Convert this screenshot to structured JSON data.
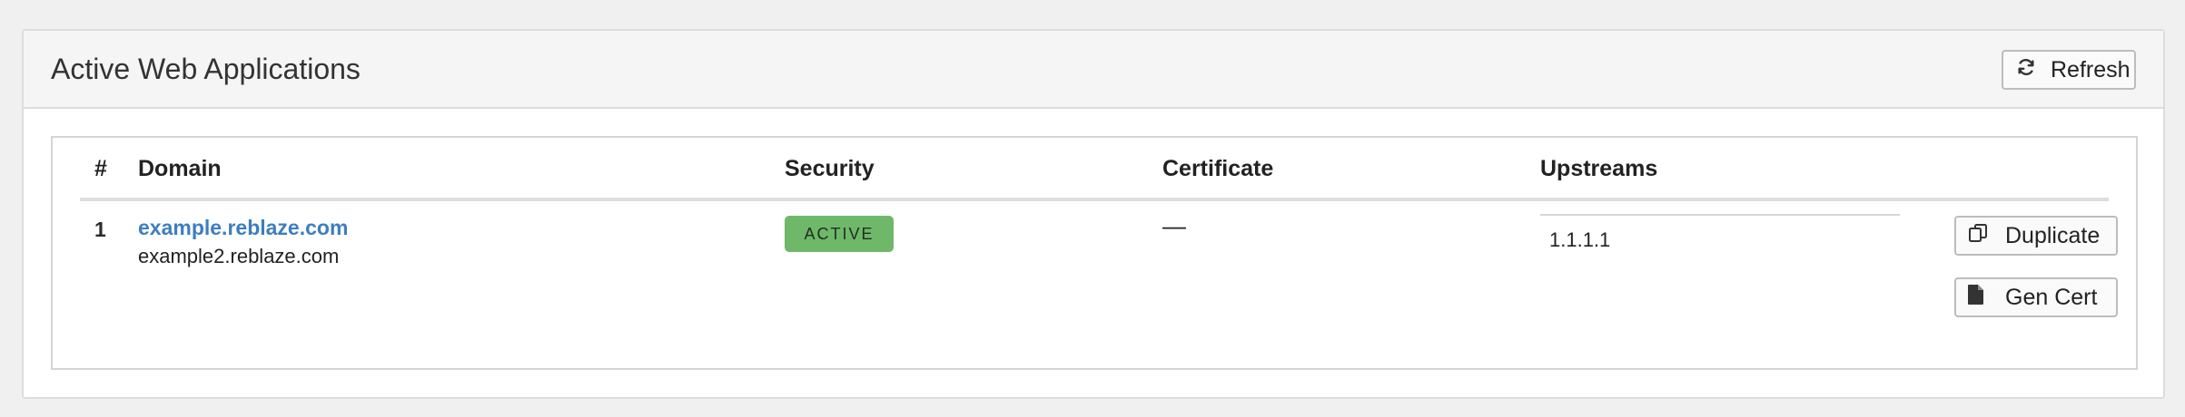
{
  "panel": {
    "title": "Active Web Applications",
    "refresh_label": "Refresh"
  },
  "table": {
    "columns": [
      "#",
      "Domain",
      "Security",
      "Certificate",
      "Upstreams"
    ],
    "rows": [
      {
        "index": "1",
        "domain_primary": "example.reblaze.com",
        "domain_secondary": "example2.reblaze.com",
        "security_status": "ACTIVE",
        "certificate": "—",
        "upstream": "1.1.1.1",
        "duplicate_label": "Duplicate",
        "gen_cert_label": "Gen Cert"
      }
    ]
  },
  "colors": {
    "link": "#3d7ebf",
    "active_badge": "#6fb86a",
    "header_bg": "#f5f5f5",
    "page_bg": "#f0f0f1"
  },
  "icons": [
    "refresh-icon",
    "duplicate-icon",
    "file-icon"
  ]
}
